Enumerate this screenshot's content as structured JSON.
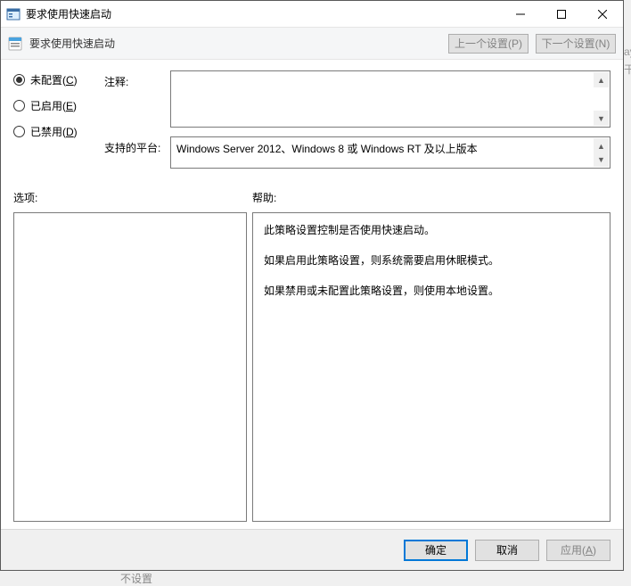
{
  "titlebar": {
    "title": "要求使用快速启动"
  },
  "toolbar": {
    "title_repeat": "要求使用快速启动",
    "prev_setting": "上一个设置(P)",
    "next_setting": "下一个设置(N)"
  },
  "radios": {
    "not_configured": {
      "label": "未配置(",
      "hotkey": "C",
      "suffix": ")",
      "selected": true
    },
    "enabled": {
      "label": "已启用(",
      "hotkey": "E",
      "suffix": ")",
      "selected": false
    },
    "disabled": {
      "label": "已禁用(",
      "hotkey": "D",
      "suffix": ")",
      "selected": false
    }
  },
  "fields": {
    "comment_label": "注释:",
    "comment_value": "",
    "platform_label": "支持的平台:",
    "platform_value": "Windows Server 2012、Windows 8 或 Windows RT 及以上版本"
  },
  "sections": {
    "options_label": "选项:",
    "help_label": "帮助:"
  },
  "help_text": {
    "p1": "此策略设置控制是否使用快速启动。",
    "p2": "如果启用此策略设置，则系统需要启用休眠模式。",
    "p3": "如果禁用或未配置此策略设置，则使用本地设置。"
  },
  "footer": {
    "ok": "确定",
    "cancel": "取消",
    "apply": "应用(",
    "apply_hotkey": "A",
    "apply_suffix": ")"
  },
  "behind": {
    "row": "不设置",
    "right1": "ay",
    "right2": "干"
  }
}
